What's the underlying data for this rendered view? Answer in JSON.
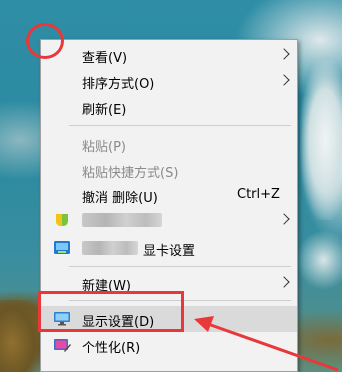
{
  "context_menu": {
    "items": [
      {
        "label": "查看(V)",
        "has_submenu": true
      },
      {
        "label": "排序方式(O)",
        "has_submenu": true
      },
      {
        "label": "刷新(E)"
      },
      {
        "label": "粘贴(P)",
        "disabled": true
      },
      {
        "label": "粘贴快捷方式(S)",
        "disabled": true
      },
      {
        "label": "撤消 删除(U)",
        "shortcut": "Ctrl+Z"
      },
      {
        "label": "",
        "has_submenu": true,
        "icon": "green-app-icon",
        "blurred": true
      },
      {
        "label": "显卡设置",
        "icon": "graphics-settings-icon",
        "blurred_prefix": true
      },
      {
        "label": "新建(W)",
        "has_submenu": true
      },
      {
        "label": "显示设置(D)",
        "icon": "display-monitor-icon",
        "highlighted": true
      },
      {
        "label": "个性化(R)",
        "icon": "personalize-icon"
      }
    ]
  },
  "annotations": {
    "color": "#e8383a"
  },
  "colors": {
    "menu_bg": "#f2f2f2",
    "hover_bg": "#dadada",
    "disabled_text": "#8a8a8a"
  }
}
